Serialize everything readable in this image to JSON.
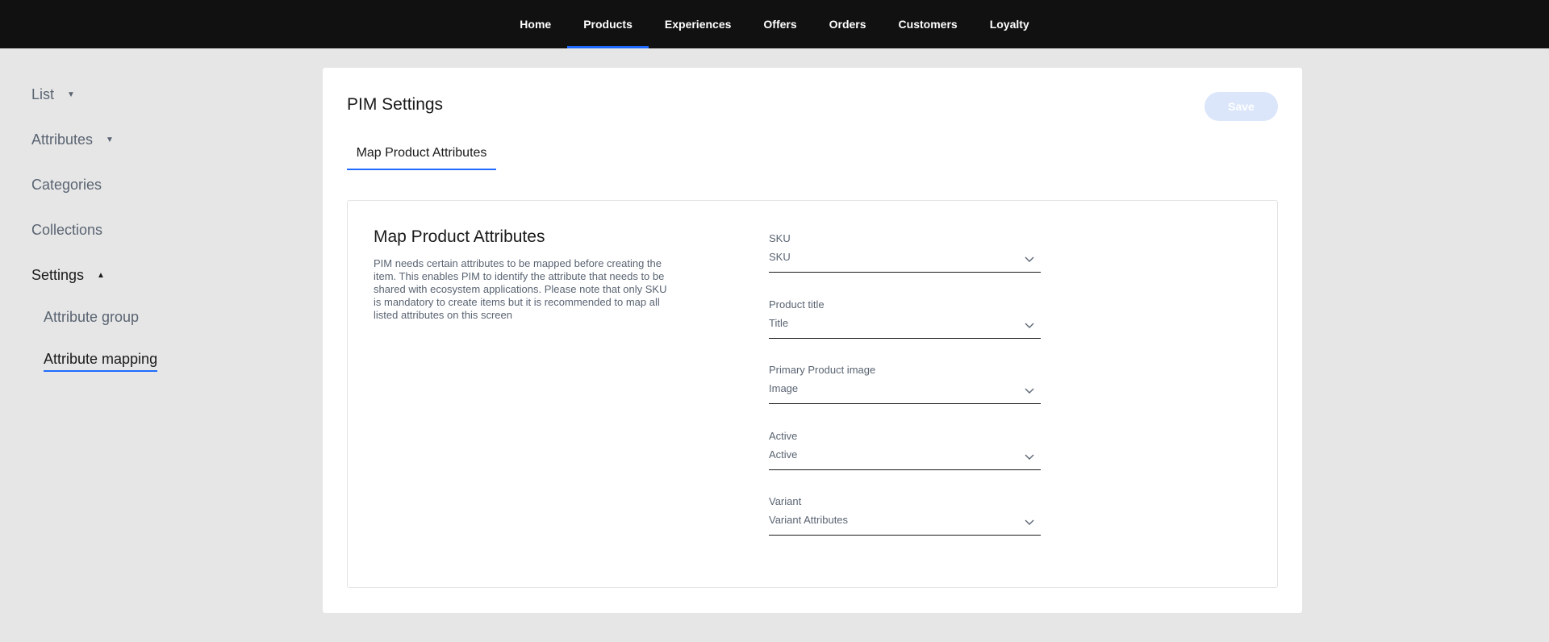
{
  "topnav": {
    "items": [
      "Home",
      "Products",
      "Experiences",
      "Offers",
      "Orders",
      "Customers",
      "Loyalty"
    ],
    "active": "Products"
  },
  "sidebar": {
    "list": "List",
    "attributes": "Attributes",
    "categories": "Categories",
    "collections": "Collections",
    "settings": "Settings",
    "attribute_group": "Attribute group",
    "attribute_mapping": "Attribute mapping"
  },
  "main": {
    "title": "PIM Settings",
    "save_label": "Save",
    "tab_label": "Map Product Attributes",
    "card_title": "Map Product Attributes",
    "card_description": "PIM needs certain attributes to be mapped before creating the item. This enables PIM to identify the attribute that needs to be shared with ecosystem applications. Please note that only SKU is mandatory to create items but it is recommended to map all listed attributes on this screen",
    "fields": [
      {
        "label": "SKU",
        "value": "SKU"
      },
      {
        "label": "Product title",
        "value": "Title"
      },
      {
        "label": "Primary Product image",
        "value": "Image"
      },
      {
        "label": "Active",
        "value": "Active"
      },
      {
        "label": "Variant",
        "value": "Variant Attributes"
      }
    ]
  },
  "colors": {
    "accent": "#1f6bff",
    "nav_bg": "#111111",
    "page_bg": "#e6e6e6",
    "save_disabled": "#dbe6fb"
  },
  "icons": {
    "collapsed_caret": "caret-down-icon",
    "expanded_caret": "caret-up-icon",
    "select_chevron": "chevron-down-icon"
  }
}
